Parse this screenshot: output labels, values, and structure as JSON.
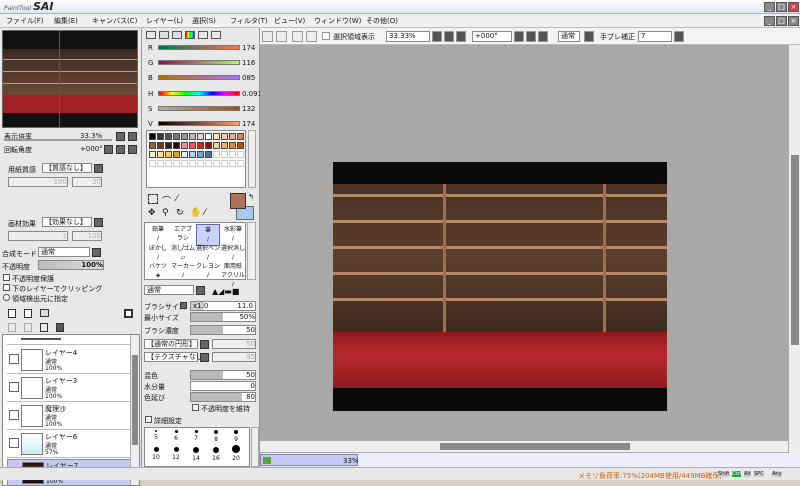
{
  "app": {
    "brand_small": "PaintTool",
    "brand_big": "SAI"
  },
  "menu": [
    "ファイル(F)",
    "編集(E)",
    "キャンバス(C)",
    "レイヤー(L)",
    "選択(S)",
    "フィルタ(T)",
    "ビュー(V)",
    "ウィンドウ(W)",
    "その他(O)"
  ],
  "toolbar": {
    "selection_label": "選択領域表示",
    "zoom": "33.33%",
    "angle": "+000°",
    "mode": "通常",
    "stabilizer_label": "手ブレ補正",
    "stabilizer_value": "7"
  },
  "navigator": {
    "zoom_label": "表示倍率",
    "zoom_value": "33.3%",
    "angle_label": "回転角度",
    "angle_value": "+000°"
  },
  "paper": {
    "texture_label": "用紙質感",
    "texture_value": "【質感なし】",
    "texture_n1": "100",
    "texture_n2": "20",
    "effect_label": "画材効果",
    "effect_value": "【効果なし】",
    "effect_n1": "1",
    "effect_n2": "100"
  },
  "layer_props": {
    "blend_label": "合成モード",
    "blend_value": "通常",
    "opacity_label": "不透明度",
    "opacity_value": "100%",
    "chk_protect": "不透明度保護",
    "chk_clip": "下のレイヤーでクリッピング",
    "chk_source": "領域検出元に指定"
  },
  "layers": [
    {
      "name": "レイヤー4",
      "mode": "通常",
      "opacity": "100%",
      "selected": false
    },
    {
      "name": "レイヤー3",
      "mode": "通常",
      "opacity": "100%",
      "selected": false
    },
    {
      "name": "魔理沙",
      "mode": "通常",
      "opacity": "100%",
      "selected": false
    },
    {
      "name": "レイヤー6",
      "mode": "通常",
      "opacity": "57%",
      "selected": false
    },
    {
      "name": "レイヤー7",
      "mode": "通常",
      "opacity": "100%",
      "selected": true
    }
  ],
  "color": {
    "r_label": "R",
    "r": "174",
    "g_label": "G",
    "g": "116",
    "b_label": "B",
    "b": "085",
    "h_label": "H",
    "h": "0.091",
    "s_label": "S",
    "s": "132",
    "v_label": "V",
    "v": "174",
    "main": "#ae7455",
    "sub": "#aac8ee"
  },
  "tools": [
    {
      "name": "鉛筆",
      "sel": false
    },
    {
      "name": "エアブラシ",
      "sel": false
    },
    {
      "name": "筆",
      "sel": true
    },
    {
      "name": "水彩筆",
      "sel": false
    },
    {
      "name": "ぼかし",
      "sel": false
    },
    {
      "name": "消しゴム",
      "sel": false
    },
    {
      "name": "選択ペン",
      "sel": false
    },
    {
      "name": "選択消し",
      "sel": false
    },
    {
      "name": "バケツ",
      "sel": false
    },
    {
      "name": "マーカー",
      "sel": false
    },
    {
      "name": "クレヨン",
      "sel": false
    },
    {
      "name": "面用紙 アクリル",
      "sel": false
    }
  ],
  "brush": {
    "mode": "通常",
    "size_label": "ブラシサイズ",
    "size_mult": "x1.0",
    "size_value": "11.0",
    "min_label": "最小サイズ",
    "min_value": "50%",
    "density_label": "ブラシ濃度",
    "density_value": "50",
    "shape_value": "【通常の円形】",
    "shape_n": "50",
    "tex_value": "【テクスチャなし】",
    "tex_n": "95",
    "blend_label": "混色",
    "blend_value": "50",
    "water_label": "水分量",
    "water_value": "0",
    "persist_label": "色延び",
    "persist_value": "80",
    "keep_opacity": "不透明度を維持",
    "advanced": "詳細設定"
  },
  "brush_sizes": [
    "5",
    "6",
    "7",
    "8",
    "9",
    "10",
    "12",
    "14",
    "16",
    "20"
  ],
  "status": {
    "canvas_zoom": "33%",
    "memory": "メモリ負荷率:75%(204MB使用/449MB確保)",
    "indicators": [
      "Shift",
      "Ctrl",
      "Alt",
      "SPC",
      "Any"
    ]
  }
}
